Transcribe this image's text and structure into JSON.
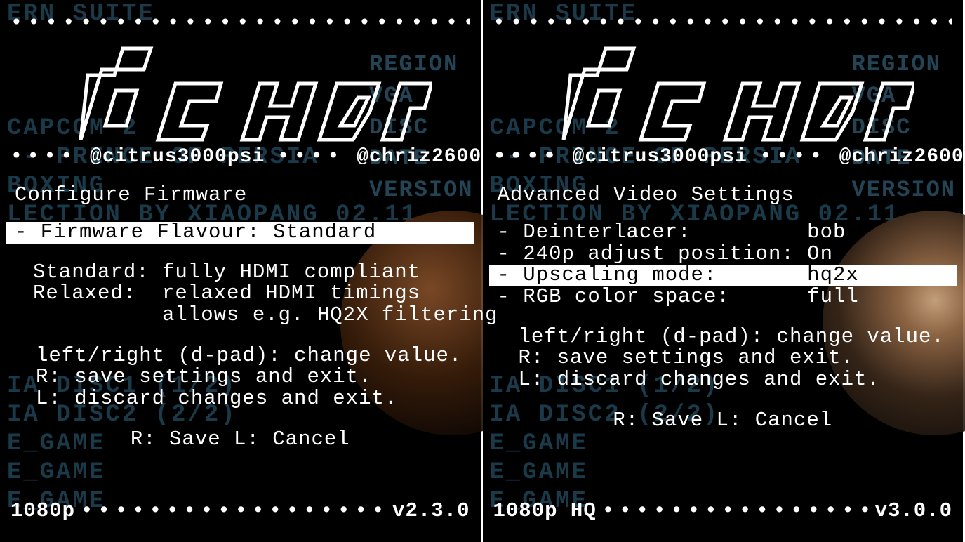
{
  "credits": {
    "a": "@citrus3000psi",
    "b": "@chriz2600"
  },
  "bg_list": "ERN SUITE\n\n\n\nCAPCOM 2\n - PRINCE OF PERSIA\nBOXING\nLECTION BY XIAOPANG 02.11\n\n\n\n\n\nIA DISC1 (1/2)\nIA DISC2 (2/2)\nE_GAME\nE_GAME\nE_GAME",
  "bg_sidebar": [
    "REGION",
    "VGA",
    "DISC",
    "DATE",
    "VERSION"
  ],
  "left": {
    "heading": "Configure Firmware",
    "rows": [
      {
        "label": "Firmware Flavour:",
        "value": "Standard",
        "selected": true
      }
    ],
    "desc": "Standard: fully HDMI compliant\nRelaxed:  relaxed HDMI timings\n          allows e.g. HQ2X filtering",
    "hints": "left/right (d-pad): change value.\nR: save settings and exit.\nL: discard changes and exit.",
    "save_cancel": "R: Save  L: Cancel",
    "footer_mode": "1080p",
    "footer_ver": "v2.3.0"
  },
  "right": {
    "heading": "Advanced Video Settings",
    "rows": [
      {
        "label": "Deinterlacer:",
        "value": "bob",
        "selected": false
      },
      {
        "label": "240p adjust position:",
        "value": "On",
        "selected": false
      },
      {
        "label": "Upscaling mode:",
        "value": "hq2x",
        "selected": true
      },
      {
        "label": "RGB color space:",
        "value": "full",
        "selected": false
      }
    ],
    "desc": "",
    "hints": "left/right (d-pad): change value.\nR: save settings and exit.\nL: discard changes and exit.",
    "save_cancel": "R: Save  L: Cancel",
    "footer_mode": "1080p HQ",
    "footer_ver": "v3.0.0"
  }
}
